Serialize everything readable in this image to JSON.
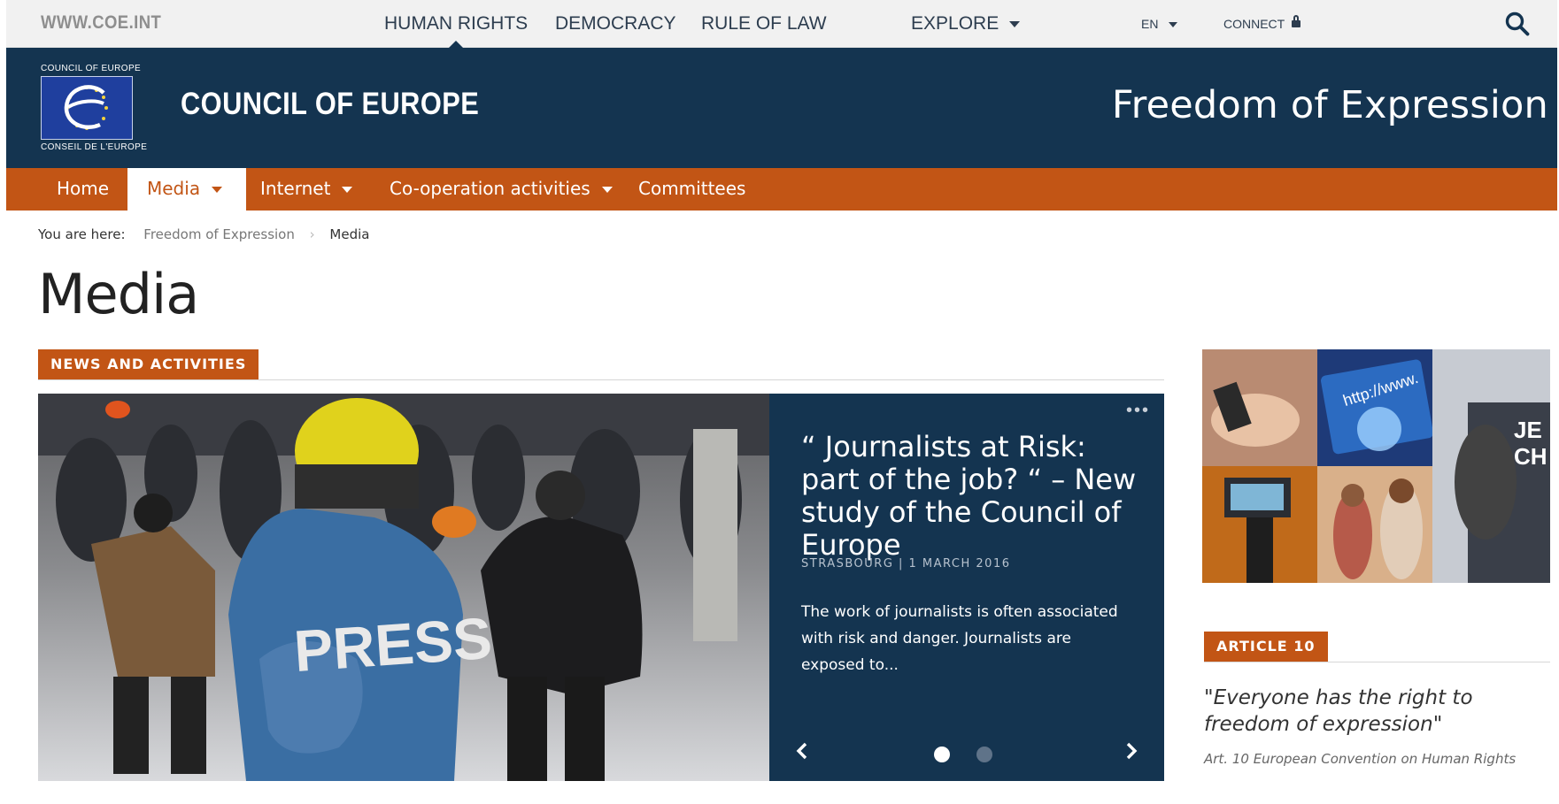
{
  "topbar": {
    "site_link": "WWW.COE.INT",
    "nav": [
      "HUMAN RIGHTS",
      "DEMOCRACY",
      "RULE OF LAW"
    ],
    "explore": "EXPLORE",
    "language": "EN",
    "connect": "CONNECT"
  },
  "header": {
    "logo_top": "COUNCIL OF EUROPE",
    "logo_bottom": "CONSEIL DE L'EUROPE",
    "brand": "COUNCIL OF EUROPE",
    "site_title": "Freedom of Expression"
  },
  "mainnav": {
    "items": [
      {
        "label": "Home"
      },
      {
        "label": "Media"
      },
      {
        "label": "Internet"
      },
      {
        "label": "Co-operation activities"
      },
      {
        "label": "Committees"
      }
    ]
  },
  "breadcrumb": {
    "prefix": "You are here:",
    "parent": "Freedom of Expression",
    "current": "Media"
  },
  "page": {
    "title": "Media"
  },
  "news": {
    "section_label": "NEWS AND ACTIVITIES",
    "photo_text": "PRESS",
    "headline": "“ Journalists at Risk: part of the job? “ – New study of the Council of Europe",
    "meta": "STRASBOURG | 1 MARCH 2016",
    "summary": "The work of journalists is often associated with risk and danger. Journalists are exposed to...",
    "slides": 2,
    "active_slide": 1
  },
  "article10": {
    "section_label": "ARTICLE 10",
    "quote": "\"Everyone has the right to freedom of expression\"",
    "source": "Art. 10 European Convention on Human Rights"
  },
  "colors": {
    "navy": "#143450",
    "orange": "#c25515",
    "topbar": "#f1f1f1"
  }
}
